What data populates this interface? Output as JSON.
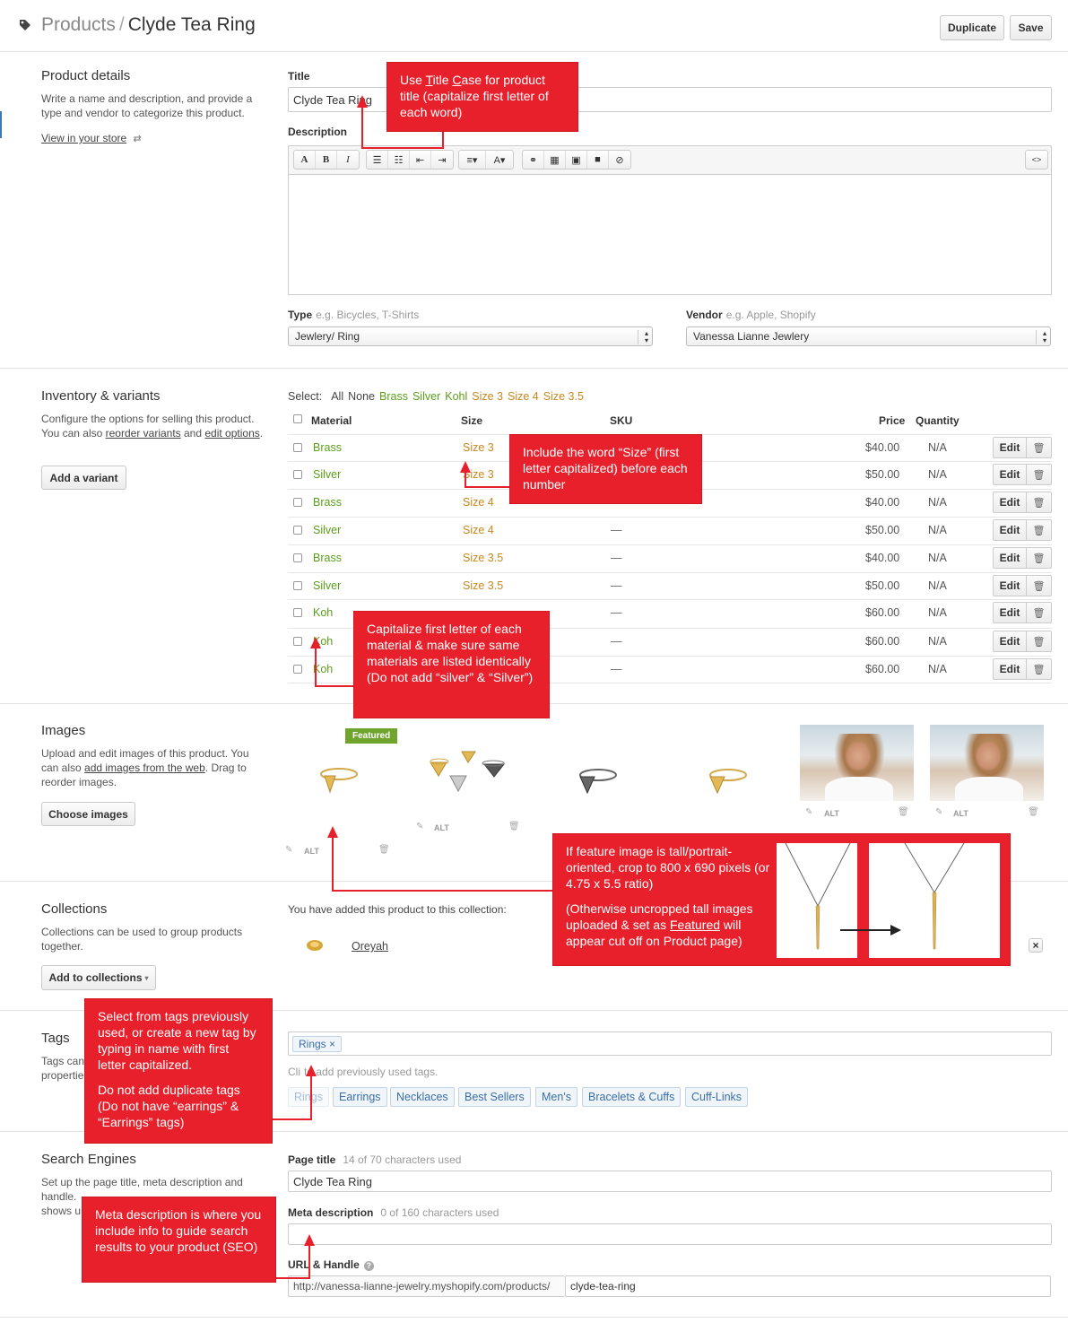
{
  "header": {
    "breadcrumb_root": "Products",
    "separator": "/",
    "title": "Clyde Tea Ring",
    "duplicate_label": "Duplicate",
    "save_label": "Save"
  },
  "product_details": {
    "section_title": "Product details",
    "description": "Write a name and description, and provide a type and vendor to categorize this product.",
    "view_link": "View in your store",
    "title_label": "Title",
    "title_value": "Clyde Tea Ring",
    "description_label": "Description",
    "type_label": "Type",
    "type_hint": "e.g. Bicycles, T-Shirts",
    "type_value": "Jewlery/ Ring",
    "vendor_label": "Vendor",
    "vendor_hint": "e.g. Apple, Shopify",
    "vendor_value": "Vanessa Lianne Jewlery"
  },
  "toolbar_icons": [
    "font-icon",
    "bold-icon",
    "italic-icon",
    "bullet-list-icon",
    "numbered-list-icon",
    "outdent-icon",
    "indent-icon",
    "align-icon",
    "text-color-icon",
    "link-icon",
    "table-icon",
    "image-icon",
    "video-icon",
    "clear-format-icon",
    "html-source-icon"
  ],
  "inventory": {
    "section_title": "Inventory & variants",
    "desc_1": "Configure the options for selling this product. You can also ",
    "reorder_link": "reorder variants",
    "desc_and": " and ",
    "edit_link": "edit options",
    "desc_end": ".",
    "add_variant_label": "Add a variant",
    "select_label": "Select:",
    "select_options": [
      {
        "label": "All",
        "color": "#444444"
      },
      {
        "label": "None",
        "color": "#444444"
      },
      {
        "label": "Brass",
        "color": "#5a9e1a"
      },
      {
        "label": "Silver",
        "color": "#5a9e1a"
      },
      {
        "label": "Kohl",
        "color": "#5a9e1a"
      },
      {
        "label": "Size 3",
        "color": "#c8861e"
      },
      {
        "label": "Size 4",
        "color": "#c8861e"
      },
      {
        "label": "Size 3.5",
        "color": "#c8861e"
      }
    ],
    "columns": {
      "material": "Material",
      "size": "Size",
      "sku": "SKU",
      "price": "Price",
      "quantity": "Quantity"
    },
    "edit_label": "Edit",
    "rows": [
      {
        "material": "Brass",
        "size": "Size 3",
        "sku": "",
        "price": "$40.00",
        "quantity": "N/A"
      },
      {
        "material": "Silver",
        "size": "Size 3",
        "sku": "",
        "price": "$50.00",
        "quantity": "N/A"
      },
      {
        "material": "Brass",
        "size": "Size 4",
        "sku": "—",
        "price": "$40.00",
        "quantity": "N/A"
      },
      {
        "material": "Silver",
        "size": "Size 4",
        "sku": "—",
        "price": "$50.00",
        "quantity": "N/A"
      },
      {
        "material": "Brass",
        "size": "Size 3.5",
        "sku": "—",
        "price": "$40.00",
        "quantity": "N/A"
      },
      {
        "material": "Silver",
        "size": "Size 3.5",
        "sku": "—",
        "price": "$50.00",
        "quantity": "N/A"
      },
      {
        "material": "Koh",
        "size": "",
        "sku": "—",
        "price": "$60.00",
        "quantity": "N/A"
      },
      {
        "material": "Koh",
        "size": "",
        "sku": "—",
        "price": "$60.00",
        "quantity": "N/A"
      },
      {
        "material": "Koh",
        "size": "",
        "sku": "—",
        "price": "$60.00",
        "quantity": "N/A"
      }
    ]
  },
  "images": {
    "section_title": "Images",
    "desc_1": "Upload and edit images of this product. You can also ",
    "web_link": "add images from the web",
    "desc_2": ". Drag to reorder images.",
    "choose_label": "Choose images",
    "featured_label": "Featured",
    "alt_label": "ALT"
  },
  "collections": {
    "section_title": "Collections",
    "description": "Collections can be used to group products together.",
    "add_label": "Add to collections",
    "added_text": "You have added this product to this collection:",
    "collection_name": "Oreyah",
    "remove_label": "×"
  },
  "tags": {
    "section_title": "Tags",
    "desc_partial_1": "Tags can",
    "desc_partial_2": "propertie",
    "current_tag": "Rings ×",
    "hint": "Click to add previously used tags.",
    "hint_visible": "Cli",
    "hint_rest": "to add previously used tags.",
    "previous": [
      "Rings",
      "Earrings",
      "Necklaces",
      "Best Sellers",
      "Men's",
      "Bracelets & Cuffs",
      "Cuff-Links"
    ]
  },
  "seo": {
    "section_title": "Search Engines",
    "desc_line_1": "Set up the page title, meta description and",
    "desc_line_2": "handle.",
    "desc_line_3": "shows u",
    "page_title_label": "Page title",
    "page_title_hint": "14 of 70 characters used",
    "page_title_value": "Clyde Tea Ring",
    "meta_label": "Meta description",
    "meta_hint": "0 of 160 characters used",
    "meta_value": "",
    "url_label": "URL & Handle",
    "url_prefix": "http://vanessa-lianne-jewelry.myshopify.com/products/",
    "handle_value": "clyde-tea-ring"
  },
  "callouts": {
    "title_case_1": "Use ",
    "title_case_t": "T",
    "title_case_mid": "itle ",
    "title_case_c": "C",
    "title_case_2": "ase for product title (capitalize first letter of each word)",
    "size": "Include the word “Size” (first letter capitalized) before each number",
    "material": "Capitalize first letter of each material & make sure same materials are listed identically (Do not add “silver” & “Silver”)",
    "image_1": "If feature image is tall/portrait-oriented, crop to 800 x 690 pixels (or 4.75 x 5.5 ratio)",
    "image_2a": "(Otherwise uncropped tall images uploaded & set as ",
    "image_2_link": "Featured",
    "image_2b": " will appear cut off on Product page)",
    "tags_1": "Select from tags previously used, or create a new tag by typing in name with first letter capitalized.",
    "tags_2": "Do not add duplicate tags (Do not have “earrings” & “Earrings” tags)",
    "seo": "Meta description is where you include info to guide search results to your product (SEO)"
  },
  "colors": {
    "callout_red": "#e8202b",
    "material_green": "#5a9e1a",
    "size_orange": "#c8861e",
    "tag_blue": "#3b6ea8",
    "featured_green": "#6fa52c"
  }
}
